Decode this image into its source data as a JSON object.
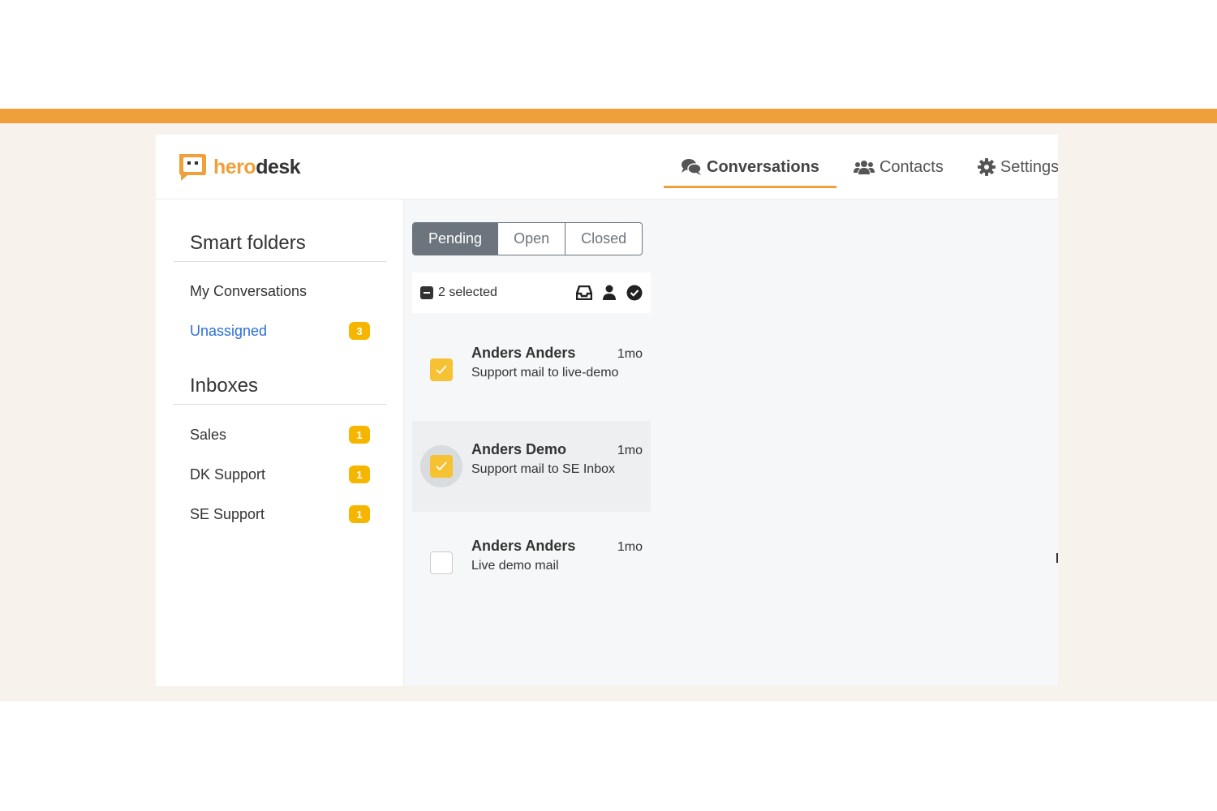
{
  "brand": {
    "hero": "hero",
    "desk": "desk",
    "accent": "#f0a03a"
  },
  "nav": [
    {
      "label": "Conversations",
      "icon": "comments-icon",
      "active": true
    },
    {
      "label": "Contacts",
      "icon": "users-icon",
      "active": false
    },
    {
      "label": "Settings",
      "icon": "gear-icon",
      "active": false
    }
  ],
  "sidebar": {
    "smart_title": "Smart folders",
    "smart_items": [
      {
        "label": "My Conversations",
        "badge": ""
      },
      {
        "label": "Unassigned",
        "badge": "3"
      }
    ],
    "inbox_title": "Inboxes",
    "inbox_items": [
      {
        "label": "Sales",
        "badge": "1"
      },
      {
        "label": "DK Support",
        "badge": "1"
      },
      {
        "label": "SE Support",
        "badge": "1"
      }
    ]
  },
  "filter": {
    "tabs": [
      "Pending",
      "Open",
      "Closed"
    ],
    "active": "Pending"
  },
  "selection": {
    "text": "2 selected"
  },
  "conversations": [
    {
      "name": "Anders Anders",
      "time": "1mo",
      "subject": "Support mail to live-demo",
      "checked": true
    },
    {
      "name": "Anders Demo",
      "time": "1mo",
      "subject": "Support mail to SE Inbox",
      "checked": true
    },
    {
      "name": "Anders Anders",
      "time": "1mo",
      "subject": "Live demo mail",
      "checked": false
    }
  ]
}
